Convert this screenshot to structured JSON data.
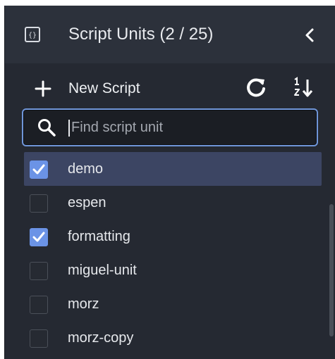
{
  "header": {
    "title": "Script Units (2 / 25)",
    "icon": "script-units-icon",
    "collapse_icon": "chevron-left-icon"
  },
  "toolbar": {
    "new_script_label": "New Script",
    "new_icon": "plus-icon",
    "refresh_icon": "refresh-icon",
    "sort_icon": "sort-icon"
  },
  "search": {
    "placeholder": "Find script unit",
    "value": ""
  },
  "list": {
    "items": [
      {
        "label": "demo",
        "checked": true,
        "selected": true
      },
      {
        "label": "espen",
        "checked": false,
        "selected": false
      },
      {
        "label": "formatting",
        "checked": true,
        "selected": false
      },
      {
        "label": "miguel-unit",
        "checked": false,
        "selected": false
      },
      {
        "label": "morz",
        "checked": false,
        "selected": false
      },
      {
        "label": "morz-copy",
        "checked": false,
        "selected": false
      }
    ]
  },
  "colors": {
    "accent": "#6b93e6",
    "panel_bg": "#252932",
    "header_bg": "#2c313b",
    "selected_row": "#3c4563",
    "search_border": "#6f95d8"
  }
}
